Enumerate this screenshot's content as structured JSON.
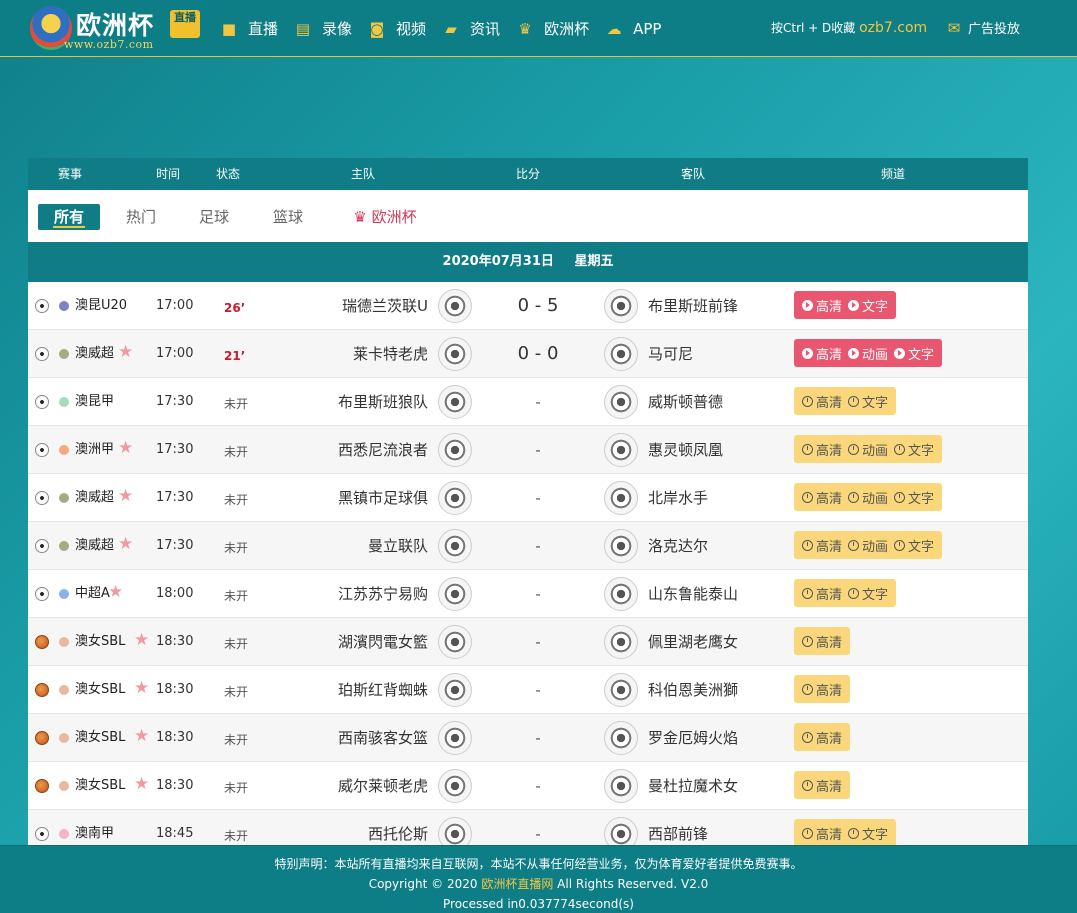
{
  "header": {
    "logo_text": "欧洲杯",
    "logo_badge": "直播",
    "logo_url": "www.ozb7.com",
    "nav": [
      {
        "label": "直播",
        "icon": "video-camera-icon"
      },
      {
        "label": "录像",
        "icon": "film-icon"
      },
      {
        "label": "视频",
        "icon": "camera-icon"
      },
      {
        "label": "资讯",
        "icon": "book-icon"
      },
      {
        "label": "欧洲杯",
        "icon": "trophy-icon"
      },
      {
        "label": "APP",
        "icon": "cloud-download-icon"
      }
    ],
    "bookmark_text": "按Ctrl + D收藏",
    "bookmark_url": "ozb7.com",
    "ad_label": "广告投放"
  },
  "table": {
    "headers": [
      "赛事",
      "时间",
      "状态",
      "主队",
      "比分",
      "客队",
      "频道"
    ],
    "filters": [
      "所有",
      "热门",
      "足球",
      "篮球",
      "欧洲杯"
    ],
    "date": "2020年07月31日",
    "weekday": "星期五",
    "rows": [
      {
        "sport": "football",
        "dot": "#7c7fc9",
        "league": "澳昆U20",
        "star": false,
        "time": "17:00",
        "status": "26’",
        "live": true,
        "home": "瑞德兰茨联U",
        "score": "0 - 5",
        "away": "布里斯班前锋",
        "channel_style": "live",
        "channels": [
          "高清",
          "文字"
        ]
      },
      {
        "sport": "football",
        "dot": "#a6ab85",
        "league": "澳威超",
        "star": true,
        "time": "17:00",
        "status": "21’",
        "live": true,
        "home": "莱卡特老虎",
        "score": "0 - 0",
        "away": "马可尼",
        "channel_style": "live",
        "channels": [
          "高清",
          "动画",
          "文字"
        ]
      },
      {
        "sport": "football",
        "dot": "#a8d9bd",
        "league": "澳昆甲",
        "star": false,
        "time": "17:30",
        "status": "未开",
        "live": false,
        "home": "布里斯班狼队",
        "score": "-",
        "away": "威斯顿普德",
        "channel_style": "soon",
        "channels": [
          "高清",
          "文字"
        ]
      },
      {
        "sport": "football",
        "dot": "#f4a982",
        "league": "澳洲甲",
        "star": true,
        "time": "17:30",
        "status": "未开",
        "live": false,
        "home": "西悉尼流浪者",
        "score": "-",
        "away": "惠灵顿凤凰",
        "channel_style": "soon",
        "channels": [
          "高清",
          "动画",
          "文字"
        ]
      },
      {
        "sport": "football",
        "dot": "#a6ab85",
        "league": "澳威超",
        "star": true,
        "time": "17:30",
        "status": "未开",
        "live": false,
        "home": "黑镇市足球俱",
        "score": "-",
        "away": "北岸水手",
        "channel_style": "soon",
        "channels": [
          "高清",
          "动画",
          "文字"
        ]
      },
      {
        "sport": "football",
        "dot": "#a6ab85",
        "league": "澳威超",
        "star": true,
        "time": "17:30",
        "status": "未开",
        "live": false,
        "home": "曼立联队",
        "score": "-",
        "away": "洛克达尔",
        "channel_style": "soon",
        "channels": [
          "高清",
          "动画",
          "文字"
        ]
      },
      {
        "sport": "football",
        "dot": "#8fb0f0",
        "league": "中超A",
        "star": true,
        "time": "18:00",
        "status": "未开",
        "live": false,
        "home": "江苏苏宁易购",
        "score": "-",
        "away": "山东鲁能泰山",
        "channel_style": "soon",
        "channels": [
          "高清",
          "文字"
        ]
      },
      {
        "sport": "basketball",
        "dot": "#e8b9a2",
        "league": "澳女SBL",
        "star": true,
        "time": "18:30",
        "status": "未开",
        "live": false,
        "home": "湖濱閃電女籃",
        "score": "-",
        "away": "佩里湖老鹰女",
        "channel_style": "soon",
        "channels": [
          "高清"
        ]
      },
      {
        "sport": "basketball",
        "dot": "#e8b9a2",
        "league": "澳女SBL",
        "star": true,
        "time": "18:30",
        "status": "未开",
        "live": false,
        "home": "珀斯红背蜘蛛",
        "score": "-",
        "away": "科伯恩美洲獅",
        "channel_style": "soon",
        "channels": [
          "高清"
        ]
      },
      {
        "sport": "basketball",
        "dot": "#e8b9a2",
        "league": "澳女SBL",
        "star": true,
        "time": "18:30",
        "status": "未开",
        "live": false,
        "home": "西南骇客女篮",
        "score": "-",
        "away": "罗金厄姆火焰",
        "channel_style": "soon",
        "channels": [
          "高清"
        ]
      },
      {
        "sport": "basketball",
        "dot": "#e8b9a2",
        "league": "澳女SBL",
        "star": true,
        "time": "18:30",
        "status": "未开",
        "live": false,
        "home": "威尔莱顿老虎",
        "score": "-",
        "away": "曼杜拉魔术女",
        "channel_style": "soon",
        "channels": [
          "高清"
        ]
      },
      {
        "sport": "football",
        "dot": "#f6b3c2",
        "league": "澳南甲",
        "star": false,
        "time": "18:45",
        "status": "未开",
        "live": false,
        "home": "西托伦斯",
        "score": "-",
        "away": "西部前锋",
        "channel_style": "soon",
        "channels": [
          "高清",
          "文字"
        ]
      }
    ]
  },
  "footer": {
    "disclaimer": "特别声明：本站所有直播均来自互联网，本站不从事任何经营业务，仅为体育爱好者提供免费赛事。",
    "copyright_prefix": "Copyright © 2020",
    "copyright_brand": "欧洲杯直播网",
    "copyright_suffix": "All Rights Reserved. V2.0",
    "processed": "Processed in0.037774second(s)"
  }
}
